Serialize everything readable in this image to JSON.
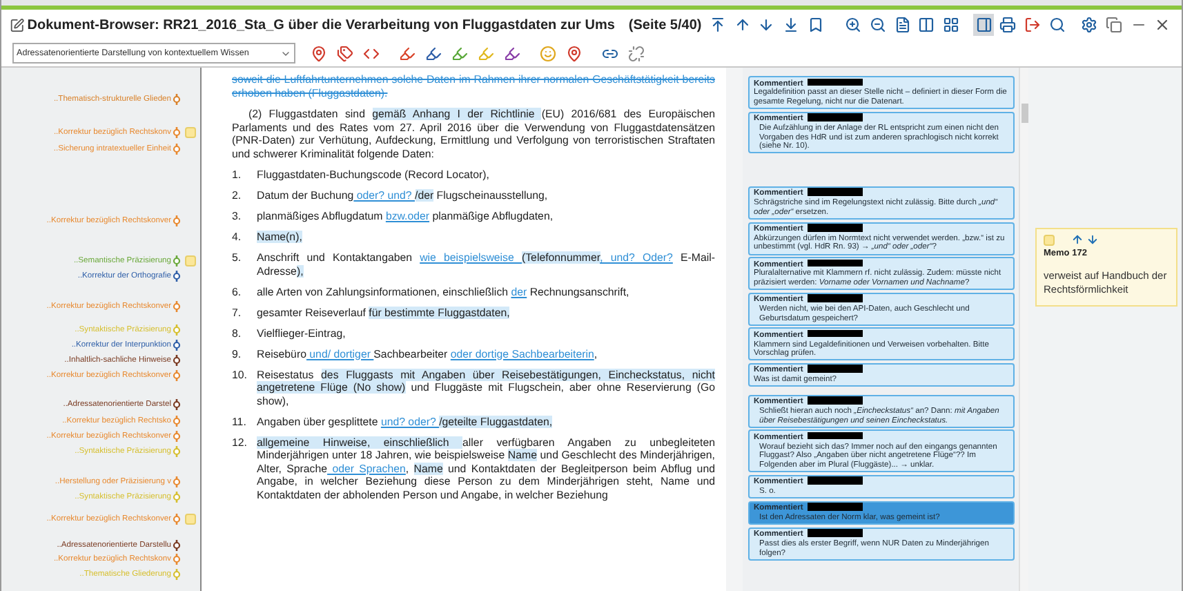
{
  "window": {
    "title": "Dokument-Browser: RR21_2016_Sta_G über die Verarbeitung von Fluggastdaten zur Ums",
    "page": "(Seite 5/40)"
  },
  "toolbar": {
    "dropdown": "Adressatenorientierte Darstellung von kontextuellem Wissen"
  },
  "codes": [
    {
      "label": "..Thematisch-strukturelle Glieden",
      "color": "#d9822b",
      "memo": false
    },
    {
      "label": "..Korrektur bezüglich Rechtskonv",
      "color": "#e8892f",
      "memo": true
    },
    {
      "label": "..Sicherung intratextueller Einheit",
      "color": "#e8892f",
      "memo": false
    },
    {
      "label": "..Korrektur bezüglich Rechtskonver",
      "color": "#e8892f",
      "memo": false
    },
    {
      "label": "..Semantische Präzisierung",
      "color": "#6aa83a",
      "memo": true
    },
    {
      "label": "..Korrektur der Orthografie",
      "color": "#2f5fa8",
      "memo": false
    },
    {
      "label": "..Korrektur bezüglich Rechtskonver",
      "color": "#e8892f",
      "memo": false
    },
    {
      "label": "..Syntaktische Präzisierung",
      "color": "#d6bf2e",
      "memo": false
    },
    {
      "label": "..Korrektur der Interpunktion",
      "color": "#2f5fa8",
      "memo": false
    },
    {
      "label": "..Inhaltlich-sachliche Hinweise",
      "color": "#7a3b22",
      "memo": false
    },
    {
      "label": "..Korrektur bezüglich Rechtskonver",
      "color": "#e8892f",
      "memo": false
    },
    {
      "label": "..Adressatenorientierte Darstel",
      "color": "#7a3b22",
      "memo": false
    },
    {
      "label": "..Korrektur bezüglich Rechtsko",
      "color": "#e8892f",
      "memo": false
    },
    {
      "label": "..Korrektur bezüglich Rechtskonver",
      "color": "#e8892f",
      "memo": false
    },
    {
      "label": "..Syntaktische Präzisierung",
      "color": "#d6bf2e",
      "memo": false
    },
    {
      "label": "..Herstellung oder Präzisierung v",
      "color": "#e8892f",
      "memo": false
    },
    {
      "label": "..Syntaktische Präzisierung",
      "color": "#d6bf2e",
      "memo": false
    },
    {
      "label": "..Korrektur bezüglich Rechtskonver",
      "color": "#e8892f",
      "memo": true
    },
    {
      "label": "..Adressatenorientierte Darstellu",
      "color": "#7a3b22",
      "memo": false
    },
    {
      "label": "..Korrektur bezüglich Rechtskonv",
      "color": "#e8892f",
      "memo": false
    },
    {
      "label": "..Thematische Gliederung",
      "color": "#d6bf2e",
      "memo": false
    }
  ],
  "document": {
    "intro": [
      {
        "kind": "struck",
        "text": "soweit die Luftfahrtunternehmen solche Daten im Rahmen ihrer normalen Geschäftstätigkeit bereits erhoben haben (Fluggastdaten)."
      }
    ],
    "paragraph": [
      {
        "kind": "plain",
        "text": "(2) Fluggastdaten sind "
      },
      {
        "kind": "highlight",
        "text": "gemäß Anhang I der Richtlinie "
      },
      {
        "kind": "plain",
        "text": "(EU) 2016/681 des Europäischen Parlaments und des Rates vom 27. April 2016 über die Verwendung von Fluggastdatensätzen (PNR-Daten) zur Verhütung, Aufdeckung, Ermittlung und Verfolgung von terroristischen Straftaten und schwerer Kriminalität folgende Daten:"
      }
    ],
    "items": [
      {
        "number": "1.",
        "segments": [
          {
            "kind": "plain",
            "text": "Fluggastdaten-Buchungscode (Record Locator),"
          }
        ]
      },
      {
        "number": "2.",
        "segments": [
          {
            "kind": "plain",
            "text": "Datum der Buchung"
          },
          {
            "kind": "insert",
            "text": " oder? und? "
          },
          {
            "kind": "highlight",
            "text": "/der"
          },
          {
            "kind": "plain",
            "text": " Flugscheinausstellung,"
          }
        ]
      },
      {
        "number": "3.",
        "segments": [
          {
            "kind": "plain",
            "text": "planmäßiges Abflugdatum "
          },
          {
            "kind": "insert",
            "text": "bzw.oder"
          },
          {
            "kind": "plain",
            "text": " planmäßige Abflugdaten,"
          }
        ]
      },
      {
        "number": "4.",
        "segments": [
          {
            "kind": "highlight",
            "text": "Name(n),"
          }
        ]
      },
      {
        "number": "5.",
        "segments": [
          {
            "kind": "plain",
            "text": "Anschrift und Kontaktangaben "
          },
          {
            "kind": "insert",
            "text": "wie beispielsweise "
          },
          {
            "kind": "highlight",
            "text": "(Telefonnummer"
          },
          {
            "kind": "insert",
            "text": ", und? Oder?"
          },
          {
            "kind": "plain",
            "text": " E-Mail-Adresse"
          },
          {
            "kind": "highlight",
            "text": "),"
          }
        ]
      },
      {
        "number": "6.",
        "segments": [
          {
            "kind": "plain",
            "text": "alle Arten von Zahlungsinformationen, einschließlich "
          },
          {
            "kind": "insert",
            "text": "der"
          },
          {
            "kind": "plain",
            "text": " Rechnungsanschrift,"
          }
        ]
      },
      {
        "number": "7.",
        "segments": [
          {
            "kind": "plain",
            "text": "gesamter Reiseverlauf "
          },
          {
            "kind": "highlight",
            "text": "für bestimmte Fluggastdaten,"
          }
        ]
      },
      {
        "number": "8.",
        "segments": [
          {
            "kind": "plain",
            "text": "Vielflieger-Eintrag,"
          }
        ]
      },
      {
        "number": "9.",
        "segments": [
          {
            "kind": "plain",
            "text": "Reisebüro"
          },
          {
            "kind": "insert",
            "text": " und/ dortiger "
          },
          {
            "kind": "plain",
            "text": "Sachbearbeiter "
          },
          {
            "kind": "insert",
            "text": "oder dortige Sachbearbeiterin"
          },
          {
            "kind": "plain",
            "text": ","
          }
        ]
      },
      {
        "number": "10.",
        "segments": [
          {
            "kind": "plain",
            "text": "Reisestatus "
          },
          {
            "kind": "highlight",
            "text": "des Fluggasts mit Angaben über Reisebestätigungen, Eincheckstatus, nicht angetretene Flüge (No show)"
          },
          {
            "kind": "plain",
            "text": " und Fluggäste mit Flugschein, aber ohne Reservierung (Go show),"
          }
        ]
      },
      {
        "number": "11.",
        "segments": [
          {
            "kind": "plain",
            "text": "Angaben über gesplittete "
          },
          {
            "kind": "insert",
            "text": "und? oder? "
          },
          {
            "kind": "highlight",
            "text": "/geteilte Fluggastdaten,"
          }
        ]
      },
      {
        "number": "12.",
        "segments": [
          {
            "kind": "highlight",
            "text": "allgemeine Hinweise, einschließlich "
          },
          {
            "kind": "plain",
            "text": "aller verfügbaren Angaben zu unbegleiteten Minderjährigen unter 18 Jahren, wie beispielsweise "
          },
          {
            "kind": "highlight",
            "text": "Name"
          },
          {
            "kind": "plain",
            "text": " und Geschlecht des Minderjährigen, Alter, Sprache"
          },
          {
            "kind": "insert",
            "text": " oder Sprachen"
          },
          {
            "kind": "plain",
            "text": ", "
          },
          {
            "kind": "highlight",
            "text": "Name"
          },
          {
            "kind": "plain",
            "text": " und Kontaktdaten der Begleitperson beim Abflug und Angabe, in welcher Beziehung diese Person zu dem Minderjährigen steht, Name und Kontaktdaten der abholenden Person und Angabe, in welcher Beziehung"
          }
        ]
      }
    ]
  },
  "comments": [
    {
      "author": "Kommentiert",
      "kind": "below",
      "selected": false,
      "text": "Legaldefinition passt an dieser Stelle nicht – definiert in dieser Form die gesamte Regelung, nicht nur die Datenart."
    },
    {
      "author": "Kommentiert",
      "kind": "inline",
      "selected": false,
      "text": "Die Aufzählung in der Anlage der RL entspricht zum einen nicht den Vorgaben des HdR und ist zum anderen sprachlogisch nicht korrekt (siehe Nr. 10)."
    },
    {
      "author": "Kommentiert",
      "kind": "below",
      "selected": false,
      "text": "Schrägstriche sind im Regelungstext nicht zulässig. Bitte durch *„und“ oder „oder“* ersetzen."
    },
    {
      "author": "Kommentiert",
      "kind": "below",
      "selected": false,
      "text": "Abkürzungen dürfen im Normtext nicht verwendet werden. „bzw.“ ist zu unbestimmt (vgl. HdR Rn. 93) → *„und“ oder „oder“*?"
    },
    {
      "author": "Kommentiert",
      "kind": "below",
      "selected": false,
      "text": "Pluralalternative mit Klammern rf. nicht zulässig. Zudem: müsste nicht präzisiert werden: *Vorname oder Vornamen und Nachname*?"
    },
    {
      "author": "Kommentiert",
      "kind": "inline",
      "selected": false,
      "text": "Werden nicht, wie bei den API-Daten, auch Geschlecht und Geburtsdatum gespeichert?"
    },
    {
      "author": "Kommentiert",
      "kind": "below",
      "selected": false,
      "text": "Klammern sind Legaldefinitionen und Verweisen vorbehalten. Bitte Vorschlag prüfen."
    },
    {
      "author": "Kommentiert",
      "kind": "below",
      "selected": false,
      "text": "Was ist damit gemeint?"
    },
    {
      "author": "Kommentiert",
      "kind": "inline",
      "selected": false,
      "text": "Schließt hieran auch noch *„Eincheckstatus“* an? Dann: *mit Angaben über Reisebestätigungen und seinen Eincheckstatus.*"
    },
    {
      "author": "Kommentiert",
      "kind": "inline",
      "selected": false,
      "text": "Worauf bezieht sich das? Immer noch auf den eingangs genannten Fluggast? Also „Angaben über nicht angetretene Flüge“?? Im Folgenden aber im Plural (Fluggäste)... → unklar."
    },
    {
      "author": "Kommentiert",
      "kind": "inline",
      "selected": false,
      "text": "S. o."
    },
    {
      "author": "Kommentiert",
      "kind": "inline",
      "selected": true,
      "text": "Ist den Adressaten der Norm klar, was gemeint ist?"
    },
    {
      "author": "Kommentiert",
      "kind": "inline",
      "selected": false,
      "text": "Passt dies als erster Begriff, wenn NUR Daten zu Minderjährigen folgen?"
    }
  ],
  "memo": {
    "title": "Memo 172",
    "text": "verweist auf Handbuch der Rechtsförmlichkeit"
  }
}
